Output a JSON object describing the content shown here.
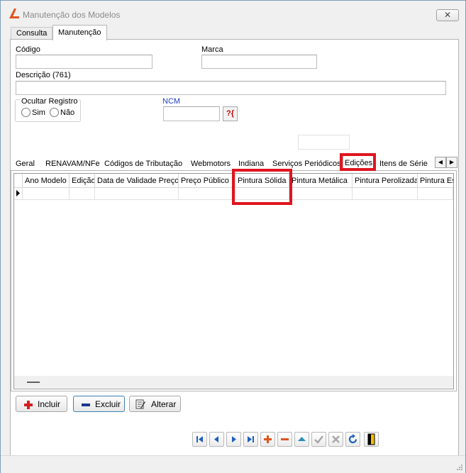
{
  "window": {
    "title": "Manutenção dos Modelos",
    "close_label": "✕"
  },
  "main_tabs": [
    {
      "label": "Consulta"
    },
    {
      "label": "Manutenção"
    }
  ],
  "form": {
    "codigo_label": "Código",
    "codigo_value": "",
    "marca_label": "Marca",
    "marca_value": "",
    "descricao_label": "Descrição (761)",
    "descricao_value": "",
    "ocultar_label": "Ocultar Registro",
    "sim_label": "Sim",
    "nao_label": "Não",
    "ncm_label": "NCM",
    "ncm_value": "",
    "lookup_label": "?{"
  },
  "sub_tabs": [
    {
      "label": "Geral"
    },
    {
      "label": "RENAVAM/NFe"
    },
    {
      "label": "Códigos de Tributação"
    },
    {
      "label": "Webmotors"
    },
    {
      "label": "Indiana"
    },
    {
      "label": "Serviços Periódicos"
    },
    {
      "label": "Edições"
    },
    {
      "label": "Itens de Série"
    }
  ],
  "grid": {
    "columns": [
      "Ano Modelo",
      "Edição",
      "Data de Validade Preço",
      "Preço Público",
      "Pintura Sólida",
      "Pintura Metálica",
      "Pintura Perolizada",
      "Pintura Es"
    ]
  },
  "buttons": {
    "incluir": "Incluir",
    "excluir": "Excluir",
    "alterar": "Alterar"
  },
  "colors": {
    "highlight": "#e0141e",
    "nav_blue": "#1f5fbf",
    "include_red": "#d42020"
  }
}
